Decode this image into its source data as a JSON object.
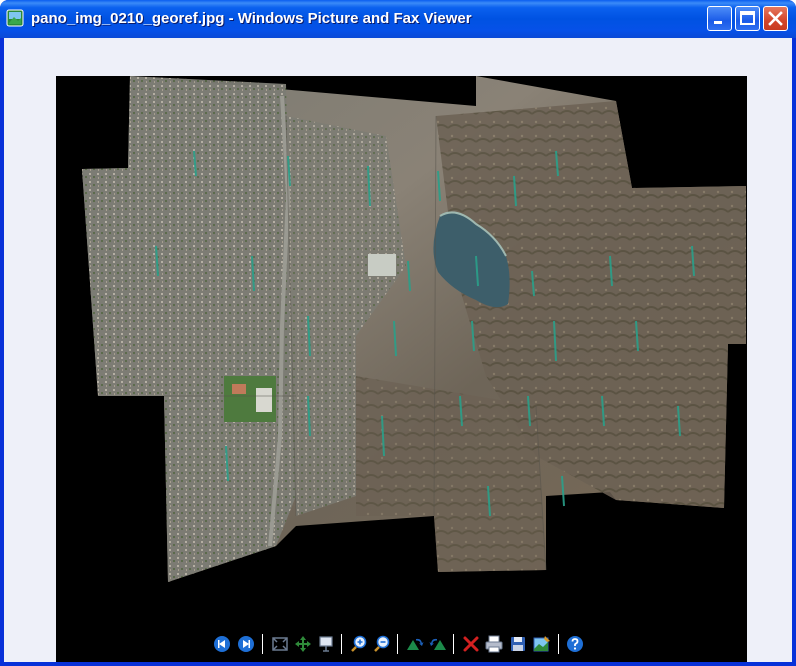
{
  "window": {
    "title": "pano_img_0210_georef.jpg - Windows Picture and Fax Viewer",
    "controls": [
      "minimize",
      "maximize",
      "close"
    ]
  },
  "image": {
    "description": "",
    "filename": "pano_img_0210_georef.jpg"
  },
  "toolbar": {
    "buttons": [
      {
        "name": "previous-image",
        "icon": "prev-icon",
        "color": "#1e6fd6"
      },
      {
        "name": "next-image",
        "icon": "next-icon",
        "color": "#1e6fd6"
      },
      {
        "name": "best-fit",
        "icon": "best-fit-icon",
        "color": "#6b7a90"
      },
      {
        "name": "actual-size",
        "icon": "actual-size-icon",
        "color": "#2f8a3a"
      },
      {
        "name": "slide-show",
        "icon": "slideshow-icon",
        "color": "#6b7a90"
      },
      {
        "name": "zoom-in",
        "icon": "zoom-in-icon",
        "color": "#1e6fd6"
      },
      {
        "name": "zoom-out",
        "icon": "zoom-out-icon",
        "color": "#1e6fd6"
      },
      {
        "name": "rotate-clockwise",
        "icon": "rotate-cw-icon",
        "color": "#1c8a4a"
      },
      {
        "name": "rotate-counterclockwise",
        "icon": "rotate-ccw-icon",
        "color": "#1c8a4a"
      },
      {
        "name": "delete",
        "icon": "delete-icon",
        "color": "#d32020"
      },
      {
        "name": "print",
        "icon": "print-icon",
        "color": "#6b7a90"
      },
      {
        "name": "copy-to",
        "icon": "save-icon",
        "color": "#2f5fb3"
      },
      {
        "name": "edit",
        "icon": "edit-icon",
        "color": "#2f8a3a"
      },
      {
        "name": "help",
        "icon": "help-icon",
        "color": "#1e6fd6"
      }
    ]
  },
  "colors": {
    "title_bar": "#0052e2",
    "window_frame": "#0831d9",
    "client_bg": "#eef0f9",
    "canvas_bg": "#000000",
    "close_button": "#d3452a"
  }
}
